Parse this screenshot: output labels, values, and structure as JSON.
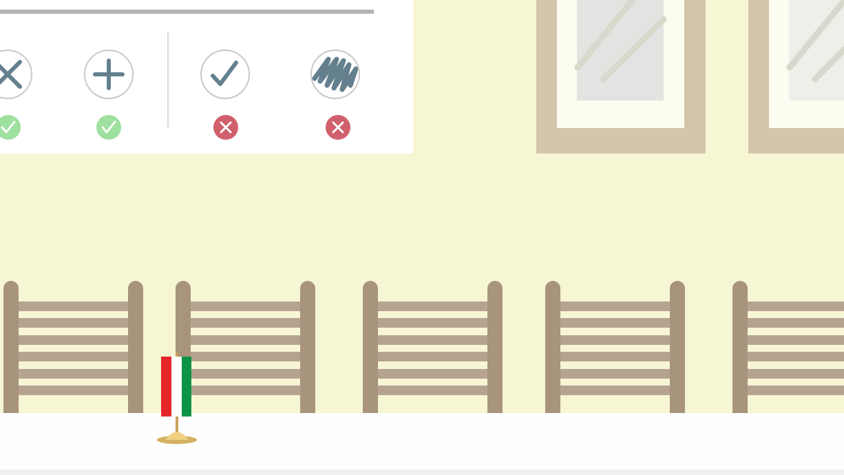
{
  "options": [
    {
      "icon": "cross-icon",
      "status": "correct"
    },
    {
      "icon": "plus-icon",
      "status": "correct"
    },
    {
      "icon": "checkmark-icon",
      "status": "incorrect"
    },
    {
      "icon": "scribble-icon",
      "status": "incorrect"
    }
  ],
  "colors": {
    "wall": "#f6f5d4",
    "panel": "#ffffff",
    "icon_stroke": "#64808f",
    "correct_badge": "#9ee0a0",
    "incorrect_badge": "#d0606c",
    "fence": "#a8937c",
    "window_frame": "#d4c6ab",
    "flag_red": "#e5262b",
    "flag_white": "#ffffff",
    "flag_green": "#0d9347"
  },
  "scene": {
    "flag": "hungarian-flag-icon",
    "windows": 2,
    "fence_sections": 5
  }
}
